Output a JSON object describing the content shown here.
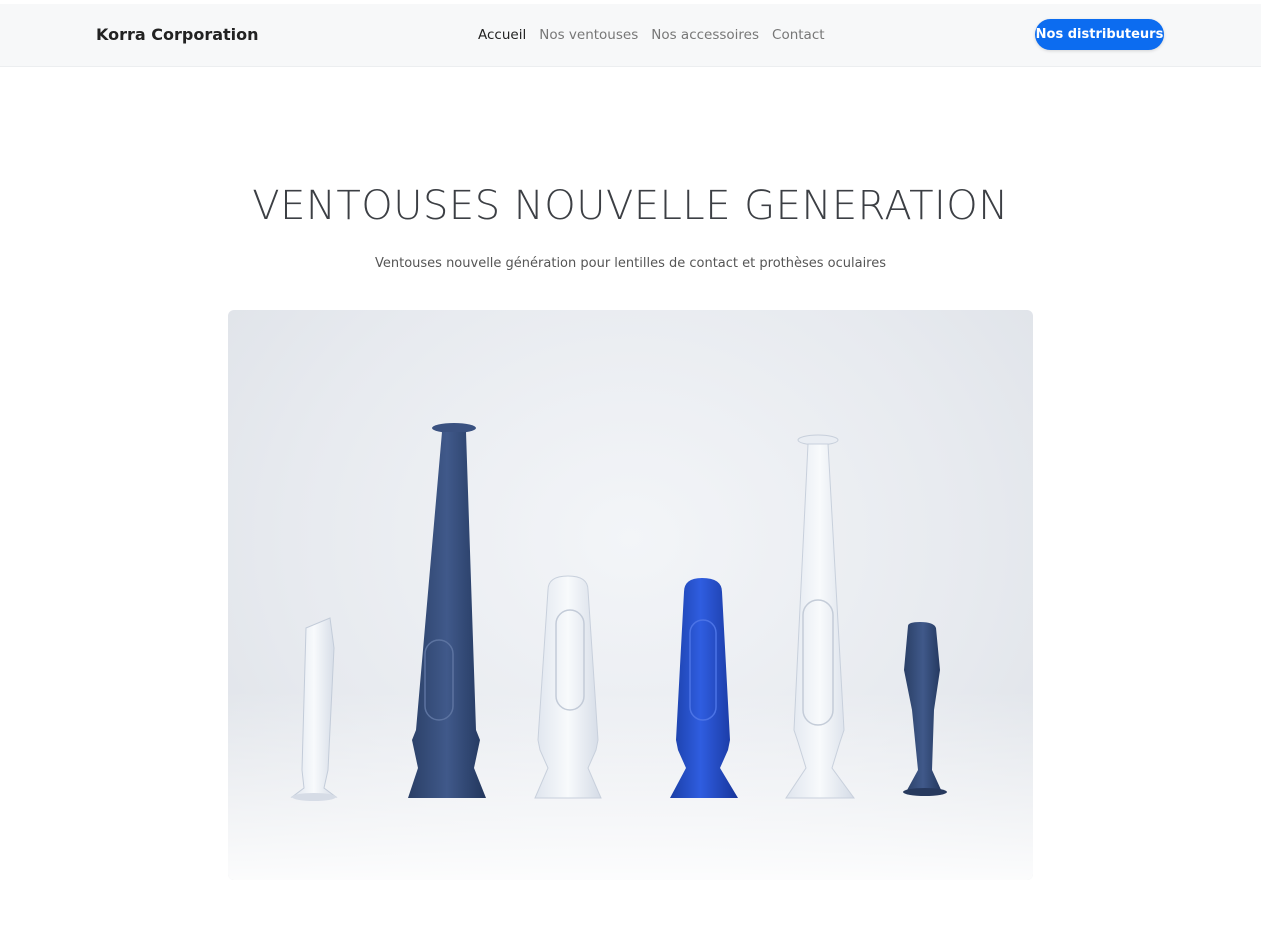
{
  "header": {
    "brand": "Korra Corporation",
    "nav": [
      {
        "label": "Accueil",
        "active": true
      },
      {
        "label": "Nos ventouses",
        "active": false
      },
      {
        "label": "Nos accessoires",
        "active": false
      },
      {
        "label": "Contact",
        "active": false
      }
    ],
    "cta_label": "Nos distributeurs"
  },
  "hero": {
    "title": "VENTOUSES NOUVELLE GENERATION",
    "subtitle": "Ventouses nouvelle génération pour lentilles de contact et prothèses oculaires"
  },
  "colors": {
    "accent": "#0c6cf0",
    "navbar_bg": "#f7f8f9"
  }
}
